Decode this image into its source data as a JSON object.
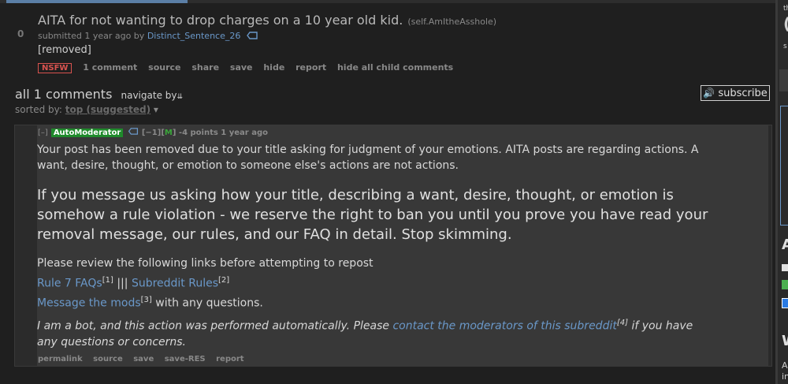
{
  "post": {
    "score": "0",
    "title": "AITA for not wanting to drop charges on a 10 year old kid.",
    "domain": "(self.AmItheAsshole)",
    "submitted_prefix": "submitted 1 year ago by",
    "author": "Distinct_Sentence_26",
    "body": "[removed]",
    "nsfw": "NSFW",
    "buttons": [
      "1 comment",
      "source",
      "share",
      "save",
      "hide",
      "report",
      "hide all child comments"
    ]
  },
  "comments_header": {
    "title": "all 1 comments",
    "navigate": "navigate by",
    "sorted_prefix": "sorted by:",
    "sorted_value": "top (suggested)",
    "subscribe": "subscribe"
  },
  "comment": {
    "expand": "[–]",
    "author": "AutoModerator",
    "flags_pre": "[−1][",
    "mod_flag": "M",
    "flags_post": "]",
    "points": "-4 points 1 year ago",
    "line1": "Your post has been removed due to your title asking for judgment of your emotions. AITA posts are regarding actions. A want, desire, thought, or emotion to someone else's actions are not actions.",
    "big": "If you message us asking how your title, describing a want, desire, thought, or emotion is somehow a rule violation - we reserve the right to ban you until you prove you have read your removal message, our rules, and our FAQ in detail. Stop skimming.",
    "review": "Please review the following links before attempting to repost",
    "rule7": "Rule 7 FAQs",
    "sup1": "[1]",
    "sep": " ||| ",
    "rules": "Subreddit Rules",
    "sup2": "[2]",
    "message": "Message the mods",
    "sup3": "[3]",
    "message_suffix": " with any questions.",
    "bot_prefix": "I am a bot, and this action was performed automatically. Please ",
    "bot_link": "contact the moderators of this subreddit",
    "sup4": "[4]",
    "bot_suffix": " if you have any questions or concerns.",
    "buttons": [
      "permalink",
      "source",
      "save",
      "save-RES",
      "report"
    ]
  },
  "sidebar": {
    "t1": "th",
    "n1": "(",
    "s1": "s",
    "a": "A",
    "w": "W",
    "a2": "A",
    "in": "in"
  },
  "colors": {
    "background": "#1f1f1f",
    "link": "#6a98c9",
    "automod": "#1f8a2b",
    "nsfw": "#d9534f"
  }
}
